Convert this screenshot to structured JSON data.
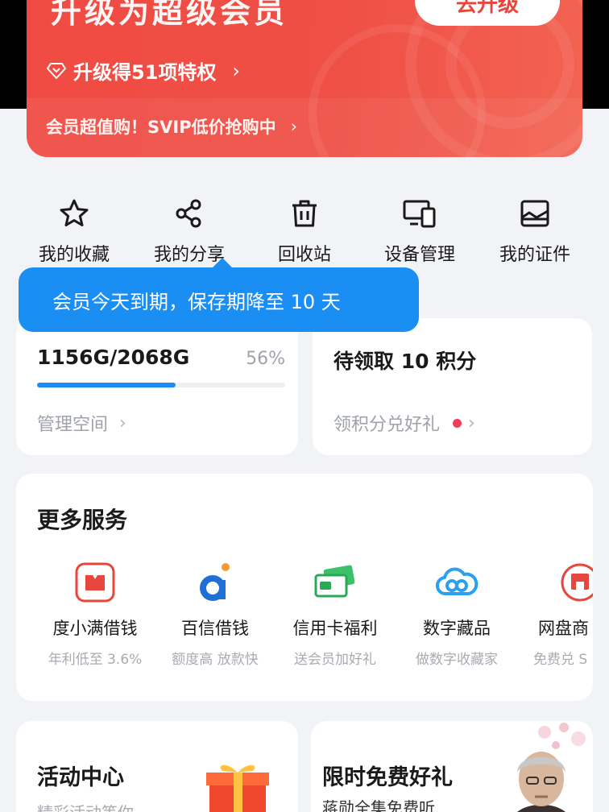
{
  "vip": {
    "title": "升级为超级会员",
    "upgrade_button": "去升级",
    "privileges": "升级得51项特权",
    "promo": "会员超值购！SVIP低价抢购中",
    "chevron": "›"
  },
  "quick_actions": [
    {
      "label": "我的收藏",
      "icon": "star-icon"
    },
    {
      "label": "我的分享",
      "icon": "share-icon"
    },
    {
      "label": "回收站",
      "icon": "trash-icon"
    },
    {
      "label": "设备管理",
      "icon": "devices-icon"
    },
    {
      "label": "我的证件",
      "icon": "id-card-icon"
    }
  ],
  "tooltip": "会员今天到期，保存期降至 10 天",
  "storage": {
    "usage": "1156G/2068G",
    "percent": "56%",
    "progress_fraction": 0.56,
    "link": "管理空间"
  },
  "points": {
    "title": "待领取 10 积分",
    "link": "领积分兑好礼"
  },
  "services": {
    "heading": "更多服务",
    "items": [
      {
        "name": "度小满借钱",
        "sub": "年利低至 3.6%",
        "icon": "du-xiaoman-icon"
      },
      {
        "name": "百信借钱",
        "sub": "额度高 放款快",
        "icon": "baixin-icon"
      },
      {
        "name": "信用卡福利",
        "sub": "送会员加好礼",
        "icon": "credit-card-icon"
      },
      {
        "name": "数字藏品",
        "sub": "做数字收藏家",
        "icon": "cloud-icon"
      },
      {
        "name": "网盘商",
        "sub": "免费兑 S",
        "icon": "store-icon"
      }
    ]
  },
  "activity": {
    "title": "活动中心",
    "sub": "精彩活动等你"
  },
  "freegift": {
    "title": "限时免费好礼",
    "sub": "蒋勋全集免费听"
  },
  "colors": {
    "brand_red": "#ef4f45",
    "accent_blue": "#1b8ef3",
    "dot_red": "#ef3d5a"
  }
}
